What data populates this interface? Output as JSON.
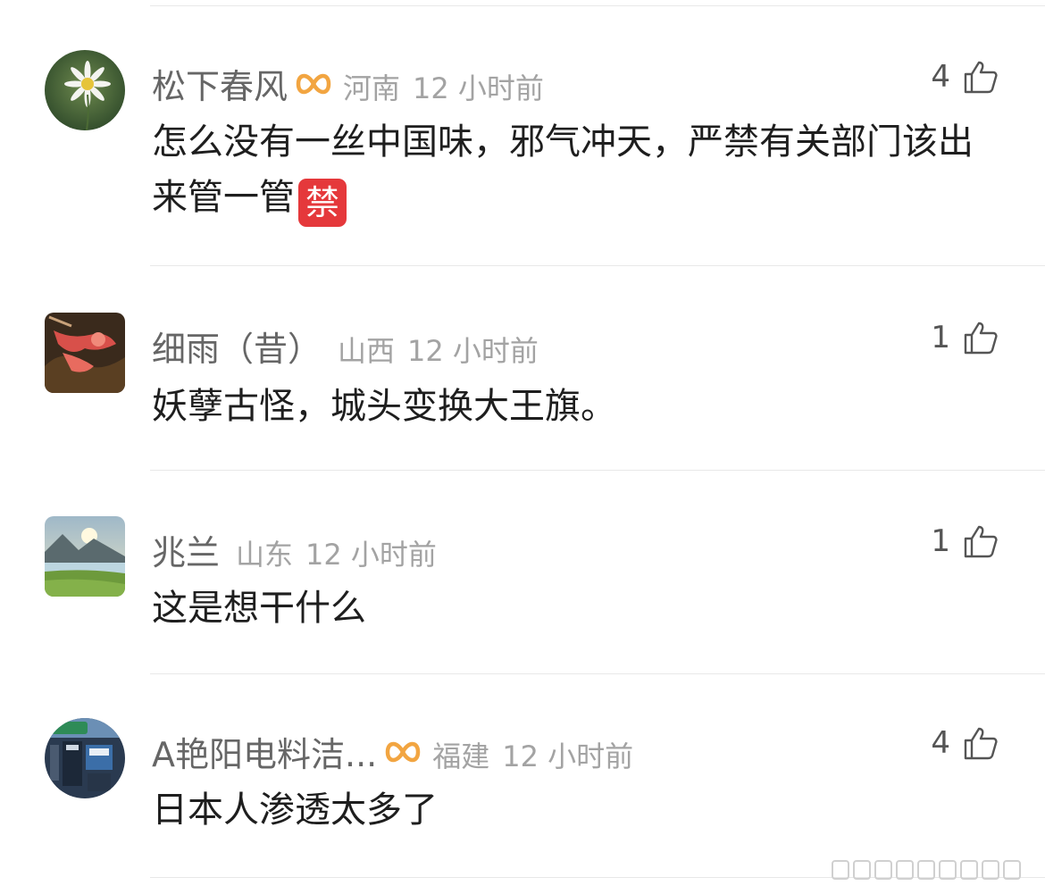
{
  "comments": [
    {
      "username": "松下春风",
      "location": "河南",
      "time": "12 小时前",
      "text": "怎么没有一丝中国味，邪气冲天，严禁有关部门该出来管一管",
      "emoji": "禁",
      "likes": "4",
      "vip_icon": "infinity-vip-icon"
    },
    {
      "username": "细雨（昔）",
      "location": "山西",
      "time": "12 小时前",
      "text": "妖孽古怪，城头变换大王旗。",
      "likes": "1"
    },
    {
      "username": "兆兰",
      "location": "山东",
      "time": "12 小时前",
      "text": "这是想干什么",
      "likes": "1"
    },
    {
      "username": "A艳阳电料洁...",
      "location": "福建",
      "time": "12 小时前",
      "text": "日本人渗透太多了",
      "likes": "4",
      "vip_icon": "infinity-vip-icon"
    }
  ],
  "colors": {
    "username": "#666666",
    "meta": "#a3a3a3",
    "text": "#1e1e1e",
    "vip": "#f2a541",
    "divider": "#e8e8e8"
  }
}
